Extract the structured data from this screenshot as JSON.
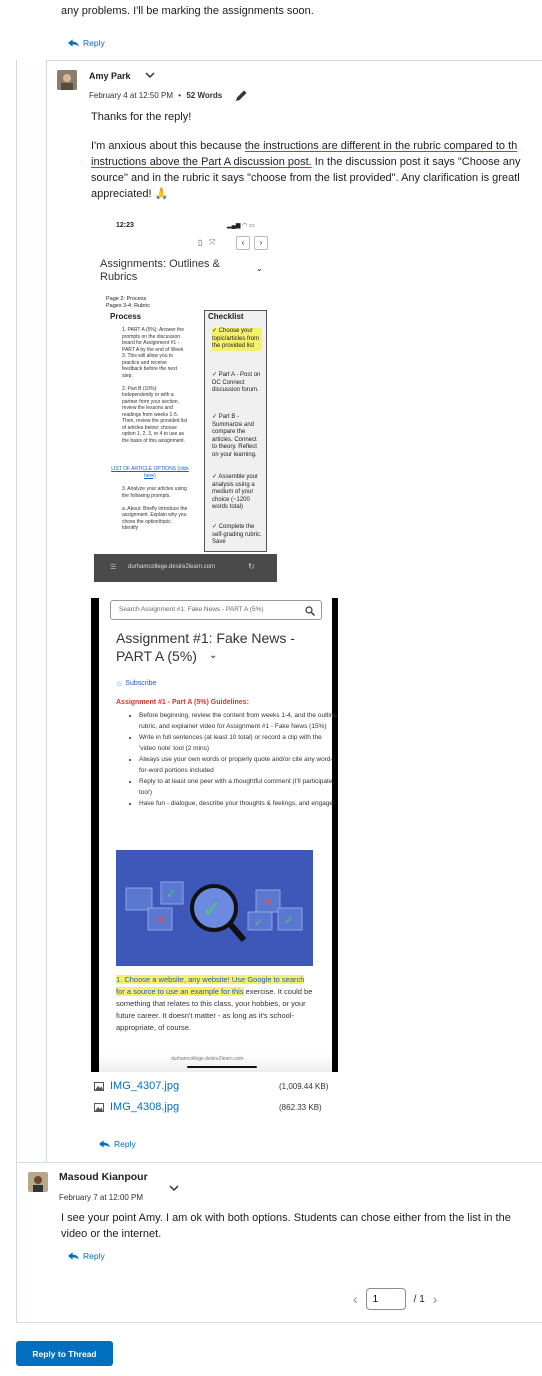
{
  "top_post": {
    "trailing_text": "any problems. I'll be marking the assignments soon.",
    "reply_label": "Reply"
  },
  "post_amy": {
    "author": "Amy Park",
    "date": "February 4 at 12:50 PM",
    "word_count": "52 Words",
    "greeting": "Thanks for the reply!",
    "para_line1_a": "I'm anxious about this because ",
    "para_line1_b": "the instructions are different in the rubric compared to th",
    "para_line2_a": "instructions above the Part A discussion post.",
    "para_line2_b": " In the discussion post it says \"Choose any",
    "para_line3": "source\" and in the rubric it says \"choose from the list provided\". Any clarification is greatl",
    "para_line4": "appreciated! 🙏",
    "reply_label": "Reply",
    "attachments": [
      {
        "name": "IMG_4307.jpg",
        "size": "(1,009.44 KB)"
      },
      {
        "name": "IMG_4308.jpg",
        "size": "(862.33 KB)"
      }
    ],
    "shot1": {
      "time": "12:23",
      "title_line1": "Assignments: Outlines &",
      "title_line2": "Rubrics",
      "pages_line1": "Page 2: Process",
      "pages_line2": "Pages 3-4: Rubric",
      "col_process": "Process",
      "col_checklist": "Checklist",
      "process_text": "1. PART A (5%): Answer the prompts on the discussion board for Assignment #1 - PART A by the end of Week 3. This will allow you to practice and receive feedback before the next step.\n\n2. Part B (10%): Independently or with a partner from your section, review the lessons and readings from weeks 1-5. Then, review the provided list of articles below; choose option 1, 2, 3, or 4 to use as the basis of this assignment.",
      "article_link": "LIST OF ARTICLE OPTIONS (click here)",
      "process_text2": "3. Analyze your articles using the following prompts.\n\na. About: Briefly introduce the assignment. Explain why you chose the option/topic. Identify",
      "check1": "✓ Choose your topic/articles from the provided list",
      "check2": "✓ Part A - Post on DC Connect discussion forum.",
      "check3": "✓ Part B - Summarize and compare the articles. Connect to theory. Reflect on your learning.",
      "check4": "✓ Assemble your analysis using a medium of your choice (~1200 words total)",
      "check5": "✓ Complete the self-grading rubric. Save",
      "url": "durhamcollege.desire2learn.com"
    },
    "shot2": {
      "search_placeholder": "Search Assignment #1: Fake News - PART A (5%)",
      "title_line1": "Assignment #1: Fake News -",
      "title_line2": "PART A (5%)",
      "subscribe": "Subscribe",
      "guidelines_heading": "Assignment #1 - Part A (5%) Guidelines:",
      "bullets": [
        "Before beginning, review the content from weeks 1-4, and the outline, rubric, and explainer video for Assignment #1 - Fake News (15%)",
        "Write in full sentences (at least 10 total) or record a clip with the 'video note' tool (2 mins)",
        "Always use your own words or properly quote and/or cite any word-for-word portions included",
        "Reply to at least one peer with a thoughtful comment (I'll participate, too!)",
        "Have fun - dialogue, describe your thoughts & feelings, and engage!"
      ],
      "step1_highlight": "1. Choose a website, any website! Use Google to search for a source to use an example for this",
      "step1_rest": "exercise. It could be something that relates to this class, your hobbies, or your future career. It doesn't matter - as long as it's school-appropriate, of course.",
      "url": "durhamcollege.desire2learn.com"
    }
  },
  "post_masoud": {
    "author": "Masoud Kianpour",
    "date": "February 7 at 12:00 PM",
    "body": "I see your point Amy. I am ok with both options. Students can chose either from the list in the video or the internet.",
    "reply_label": "Reply"
  },
  "pager": {
    "current": "1",
    "total": "/ 1"
  },
  "reply_thread_label": "Reply to Thread",
  "colors": {
    "link": "#006fbf",
    "border": "#d3d9e3",
    "highlight": "#f7f06b",
    "red": "#d9342b"
  }
}
